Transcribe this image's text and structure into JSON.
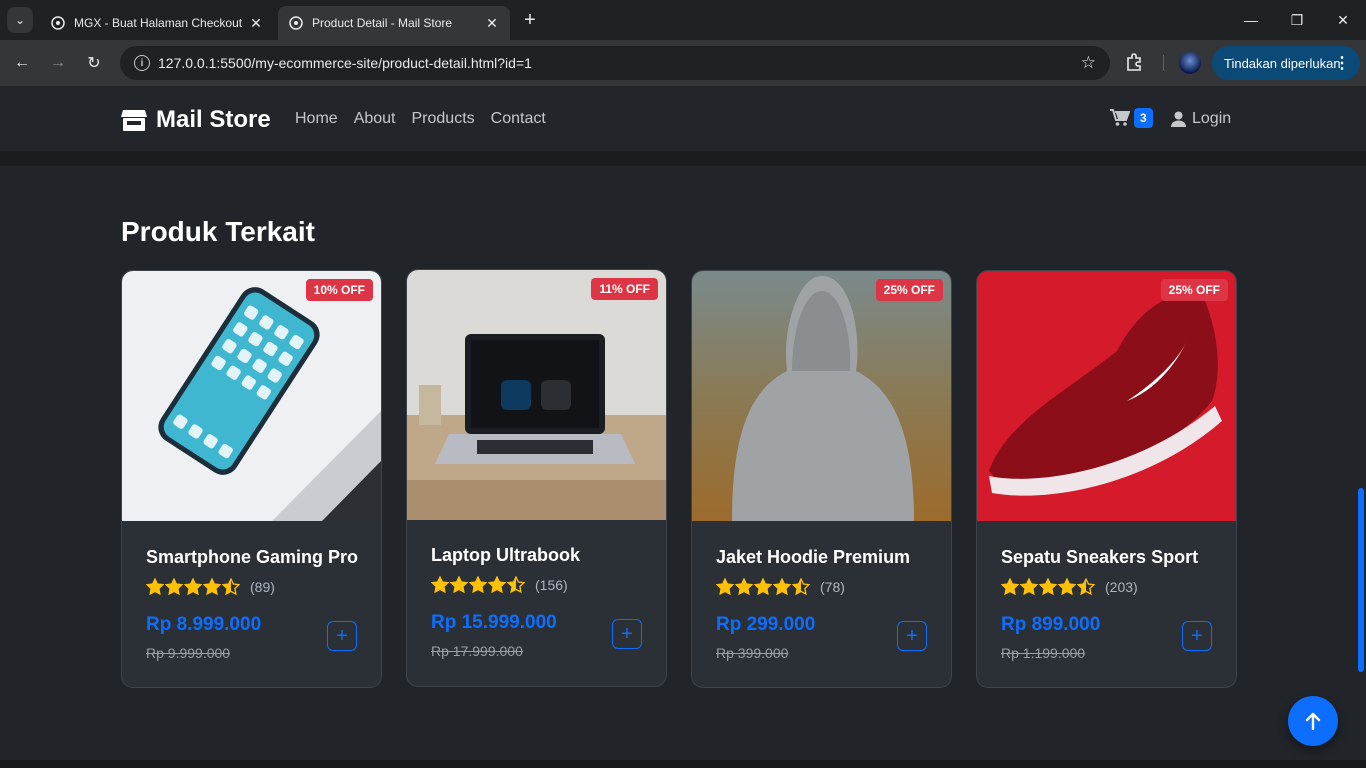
{
  "browser": {
    "tabs": [
      {
        "title": "MGX - Buat Halaman Checkout"
      },
      {
        "title": "Product Detail - Mail Store"
      }
    ],
    "url": "127.0.0.1:5500/my-ecommerce-site/product-detail.html?id=1",
    "action_button": "Tindakan diperlukan"
  },
  "navbar": {
    "brand": "Mail Store",
    "links": [
      "Home",
      "About",
      "Products",
      "Contact"
    ],
    "cart_count": "3",
    "login": "Login"
  },
  "section": {
    "title": "Produk Terkait"
  },
  "products": [
    {
      "name": "Smartphone Gaming Pro",
      "discount": "10% OFF",
      "rating": 4.5,
      "reviews": "(89)",
      "price": "Rp 8.999.000",
      "old_price": "Rp 9.999.000"
    },
    {
      "name": "Laptop Ultrabook",
      "discount": "11% OFF",
      "rating": 4.5,
      "reviews": "(156)",
      "price": "Rp 15.999.000",
      "old_price": "Rp 17.999.000"
    },
    {
      "name": "Jaket Hoodie Premium",
      "discount": "25% OFF",
      "rating": 4.5,
      "reviews": "(78)",
      "price": "Rp 299.000",
      "old_price": "Rp 399.000"
    },
    {
      "name": "Sepatu Sneakers Sport",
      "discount": "25% OFF",
      "rating": 4.5,
      "reviews": "(203)",
      "price": "Rp 899.000",
      "old_price": "Rp 1.199.000"
    }
  ],
  "colors": {
    "accent": "#0d6efd",
    "discount": "#dc3545",
    "star": "#ffc107"
  }
}
